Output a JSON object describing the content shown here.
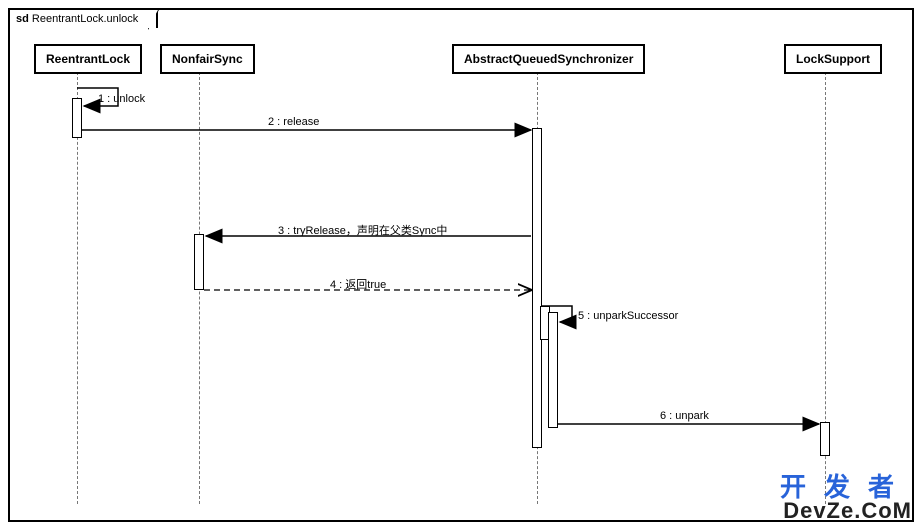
{
  "frame": {
    "sd_prefix": "sd",
    "title": "ReentrantLock.unlock"
  },
  "participants": {
    "p1": "ReentrantLock",
    "p2": "NonfairSync",
    "p3": "AbstractQueuedSynchronizer",
    "p4": "LockSupport"
  },
  "messages": {
    "m1": "1 : unlock",
    "m2": "2 : release",
    "m3": "3 : tryRelease，声明在父类Sync中",
    "m4": "4 : 返回true",
    "m5": "5 : unparkSuccessor",
    "m6": "6 : unpark"
  },
  "watermark": {
    "cn": "开发者",
    "en": "DevZe.CoM"
  }
}
